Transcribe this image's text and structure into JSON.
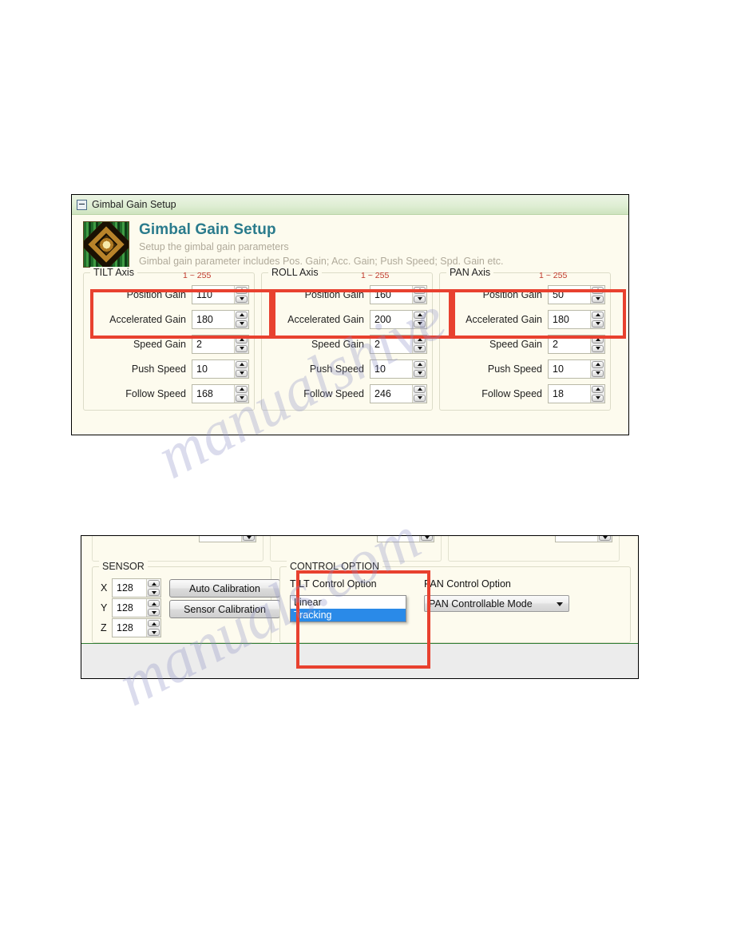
{
  "window1": {
    "titlebar": {
      "collapse_icon": "collapse-minus-icon",
      "title": "Gimbal Gain Setup"
    },
    "header": {
      "icon": "gimbal-chip-icon",
      "title": "Gimbal Gain Setup",
      "subtitle_line1": "Setup the gimbal gain parameters",
      "subtitle_line2": "Gimbal gain parameter includes Pos. Gain; Acc. Gain; Push Speed; Spd. Gain etc."
    },
    "range_hint": "1 ~ 255",
    "axes": [
      {
        "legend": "TILT Axis",
        "fields": [
          {
            "label": "Position Gain",
            "value": "110"
          },
          {
            "label": "Accelerated Gain",
            "value": "180"
          },
          {
            "label": "Speed Gain",
            "value": "2"
          },
          {
            "label": "Push Speed",
            "value": "10"
          },
          {
            "label": "Follow Speed",
            "value": "168"
          }
        ]
      },
      {
        "legend": "ROLL Axis",
        "fields": [
          {
            "label": "Position Gain",
            "value": "160"
          },
          {
            "label": "Accelerated Gain",
            "value": "200"
          },
          {
            "label": "Speed Gain",
            "value": "2"
          },
          {
            "label": "Push Speed",
            "value": "10"
          },
          {
            "label": "Follow Speed",
            "value": "246"
          }
        ]
      },
      {
        "legend": "PAN Axis",
        "fields": [
          {
            "label": "Position Gain",
            "value": "50"
          },
          {
            "label": "Accelerated Gain",
            "value": "180"
          },
          {
            "label": "Speed Gain",
            "value": "2"
          },
          {
            "label": "Push Speed",
            "value": "10"
          },
          {
            "label": "Follow Speed",
            "value": "18"
          }
        ]
      }
    ],
    "highlight_color": "#e8412f"
  },
  "window2": {
    "sensor": {
      "legend": "SENSOR",
      "axes": [
        {
          "label": "X",
          "value": "128"
        },
        {
          "label": "Y",
          "value": "128"
        },
        {
          "label": "Z",
          "value": "128"
        }
      ],
      "buttons": [
        {
          "label": "Auto Calibration"
        },
        {
          "label": "Sensor Calibration"
        }
      ]
    },
    "control_option": {
      "legend": "CONTROL OPTION",
      "tilt": {
        "label": "TILT Control Option",
        "selected": "Tracking",
        "options": [
          {
            "label": "Linear",
            "selected": false
          },
          {
            "label": "Tracking",
            "selected": true
          }
        ]
      },
      "pan": {
        "label": "PAN Control Option",
        "selected": "PAN Controllable Mode"
      }
    },
    "highlight_color": "#e8412f"
  },
  "watermark": {
    "line_a": "manualshive",
    "line_b": "manuals.com"
  }
}
